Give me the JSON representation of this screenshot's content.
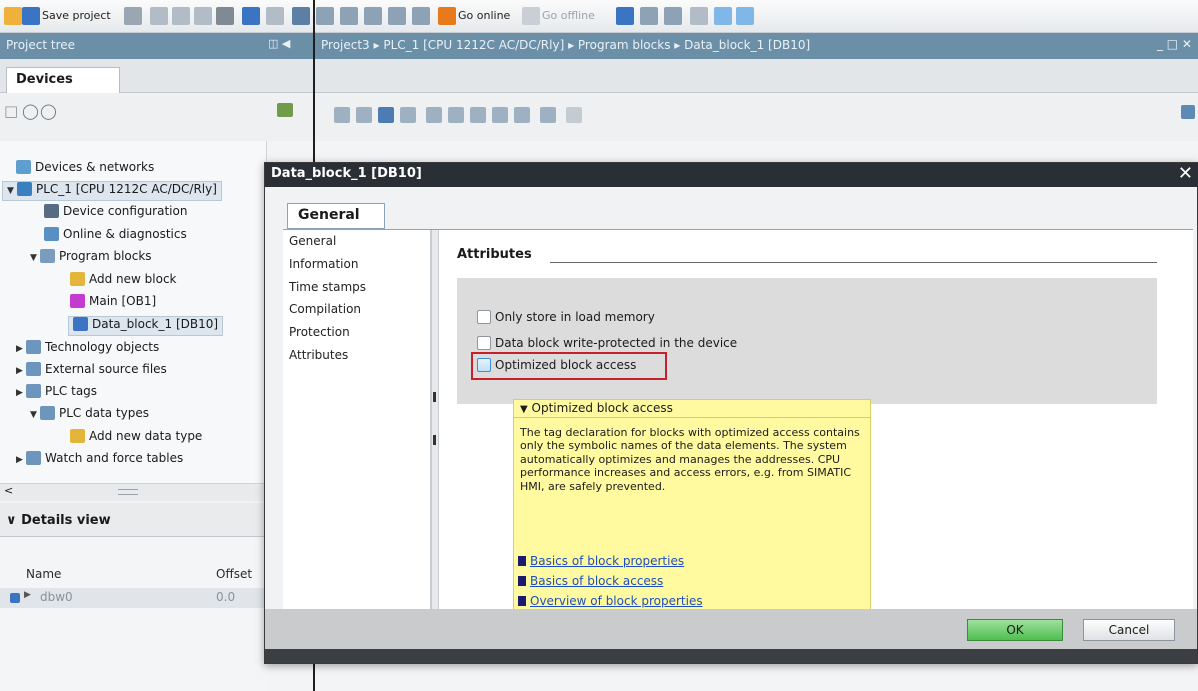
{
  "toolbar": {
    "save_label": "Save project",
    "go_online_label": "Go online",
    "go_offline_label": "Go offline"
  },
  "project_tree": {
    "title": "Project tree",
    "devices_tab": "Devices",
    "items": [
      {
        "label": "Devices & networks"
      },
      {
        "label": "PLC_1 [CPU 1212C AC/DC/Rly]"
      },
      {
        "label": "Device configuration"
      },
      {
        "label": "Online & diagnostics"
      },
      {
        "label": "Program blocks"
      },
      {
        "label": "Add new block"
      },
      {
        "label": "Main [OB1]"
      },
      {
        "label": "Data_block_1 [DB10]"
      },
      {
        "label": "Technology objects"
      },
      {
        "label": "External source files"
      },
      {
        "label": "PLC tags"
      },
      {
        "label": "PLC data types"
      },
      {
        "label": "Add new data type"
      },
      {
        "label": "Watch and force tables"
      }
    ]
  },
  "details_view": {
    "title": "Details view",
    "columns": [
      "Name",
      "Offset"
    ],
    "rows": [
      {
        "name": "dbw0",
        "offset": "0.0"
      }
    ]
  },
  "breadcrumb": "Project3 ▸ PLC_1 [CPU 1212C AC/DC/Rly] ▸ Program blocks ▸ Data_block_1 [DB10]",
  "dialog": {
    "title": "Data_block_1 [DB10]",
    "tab": "General",
    "nav": [
      "General",
      "Information",
      "Time stamps",
      "Compilation",
      "Protection",
      "Attributes"
    ],
    "section_title": "Attributes",
    "checkboxes": [
      {
        "label": "Only store in load memory",
        "checked": false
      },
      {
        "label": "Data block write-protected in the device",
        "checked": false
      },
      {
        "label": "Optimized block access",
        "checked": false
      }
    ],
    "tooltip": {
      "title": "Optimized block access",
      "body": "The tag declaration for blocks with optimized access contains only the symbolic names of the data elements. The system automatically optimizes and manages the addresses. CPU performance increases and access errors, e.g. from SIMATIC HMI, are safely prevented.",
      "links": [
        "Basics of block properties",
        "Basics of block access",
        "Overview of block properties"
      ]
    },
    "ok_label": "OK",
    "cancel_label": "Cancel"
  },
  "colors": {
    "title_bar": "#6c8fa8",
    "dialog_title": "#2a2f35",
    "highlight": "#c8202a",
    "tooltip_bg": "#fffaa0",
    "ok_green": "#4fbf4f"
  }
}
